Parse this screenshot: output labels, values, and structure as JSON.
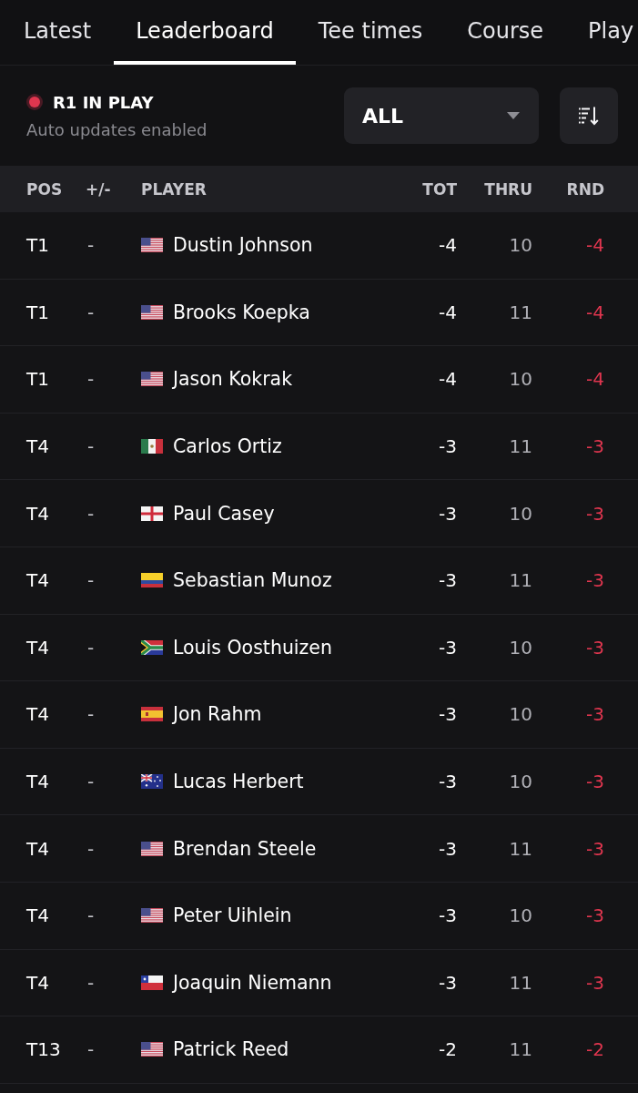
{
  "tabs": [
    {
      "label": "Latest",
      "selected": false
    },
    {
      "label": "Leaderboard",
      "selected": true
    },
    {
      "label": "Tee times",
      "selected": false
    },
    {
      "label": "Course",
      "selected": false
    },
    {
      "label": "Play",
      "selected": false
    }
  ],
  "round_status": {
    "title": "R1 IN PLAY",
    "subtitle": "Auto updates enabled"
  },
  "filter": {
    "value": "ALL"
  },
  "table": {
    "columns": [
      "POS",
      "+/-",
      "PLAYER",
      "TOT",
      "THRU",
      "RND"
    ],
    "rows": [
      {
        "pos": "T1",
        "move": "-",
        "kind": "us",
        "player": "Dustin Johnson",
        "tot": "-4",
        "thru": "10",
        "rnd": "-4"
      },
      {
        "pos": "T1",
        "move": "-",
        "kind": "us",
        "player": "Brooks Koepka",
        "tot": "-4",
        "thru": "11",
        "rnd": "-4"
      },
      {
        "pos": "T1",
        "move": "-",
        "kind": "us",
        "player": "Jason Kokrak",
        "tot": "-4",
        "thru": "10",
        "rnd": "-4"
      },
      {
        "pos": "T4",
        "move": "-",
        "kind": "mx",
        "player": "Carlos Ortiz",
        "tot": "-3",
        "thru": "11",
        "rnd": "-3"
      },
      {
        "pos": "T4",
        "move": "-",
        "kind": "eng",
        "player": "Paul Casey",
        "tot": "-3",
        "thru": "10",
        "rnd": "-3"
      },
      {
        "pos": "T4",
        "move": "-",
        "kind": "co",
        "player": "Sebastian Munoz",
        "tot": "-3",
        "thru": "11",
        "rnd": "-3"
      },
      {
        "pos": "T4",
        "move": "-",
        "kind": "za",
        "player": "Louis Oosthuizen",
        "tot": "-3",
        "thru": "10",
        "rnd": "-3"
      },
      {
        "pos": "T4",
        "move": "-",
        "kind": "es",
        "player": "Jon Rahm",
        "tot": "-3",
        "thru": "10",
        "rnd": "-3"
      },
      {
        "pos": "T4",
        "move": "-",
        "kind": "au",
        "player": "Lucas Herbert",
        "tot": "-3",
        "thru": "10",
        "rnd": "-3"
      },
      {
        "pos": "T4",
        "move": "-",
        "kind": "us",
        "player": "Brendan Steele",
        "tot": "-3",
        "thru": "11",
        "rnd": "-3"
      },
      {
        "pos": "T4",
        "move": "-",
        "kind": "us",
        "player": "Peter Uihlein",
        "tot": "-3",
        "thru": "10",
        "rnd": "-3"
      },
      {
        "pos": "T4",
        "move": "-",
        "kind": "cl",
        "player": "Joaquin Niemann",
        "tot": "-3",
        "thru": "11",
        "rnd": "-3"
      },
      {
        "pos": "T13",
        "move": "-",
        "kind": "us",
        "player": "Patrick Reed",
        "tot": "-2",
        "thru": "11",
        "rnd": "-2"
      }
    ]
  }
}
